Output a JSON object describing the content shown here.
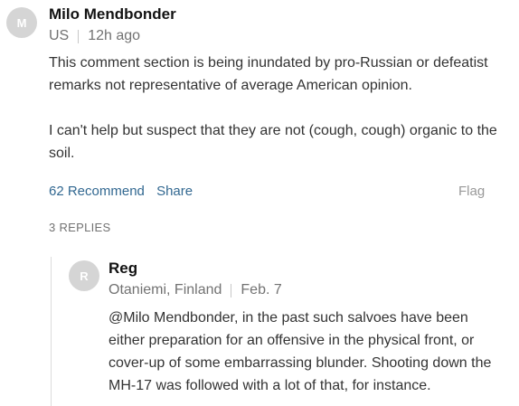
{
  "comment": {
    "avatar_letter": "M",
    "author": "Milo Mendbonder",
    "location": "US",
    "time": "12h ago",
    "paragraphs": [
      "This comment section is being inundated by pro-Russian or defeatist remarks not representative of average American opinion.",
      "I can't help but suspect that they are not (cough, cough) organic to the soil."
    ],
    "recommend_label": "62 Recommend",
    "share_label": "Share",
    "flag_label": "Flag",
    "replies_label": "3 REPLIES"
  },
  "reply": {
    "avatar_letter": "R",
    "author": "Reg",
    "location": "Otaniemi, Finland",
    "time": "Feb. 7",
    "text": "@Milo Mendbonder, in the past such salvoes have been either preparation for an offensive in the physical front, or cover-up of some embarrassing blunder. Shooting down the MH-17 was followed with a lot of that, for instance."
  },
  "colors": {
    "link": "#326891",
    "meta": "#727272",
    "avatar_bg": "#d5d5d5"
  }
}
